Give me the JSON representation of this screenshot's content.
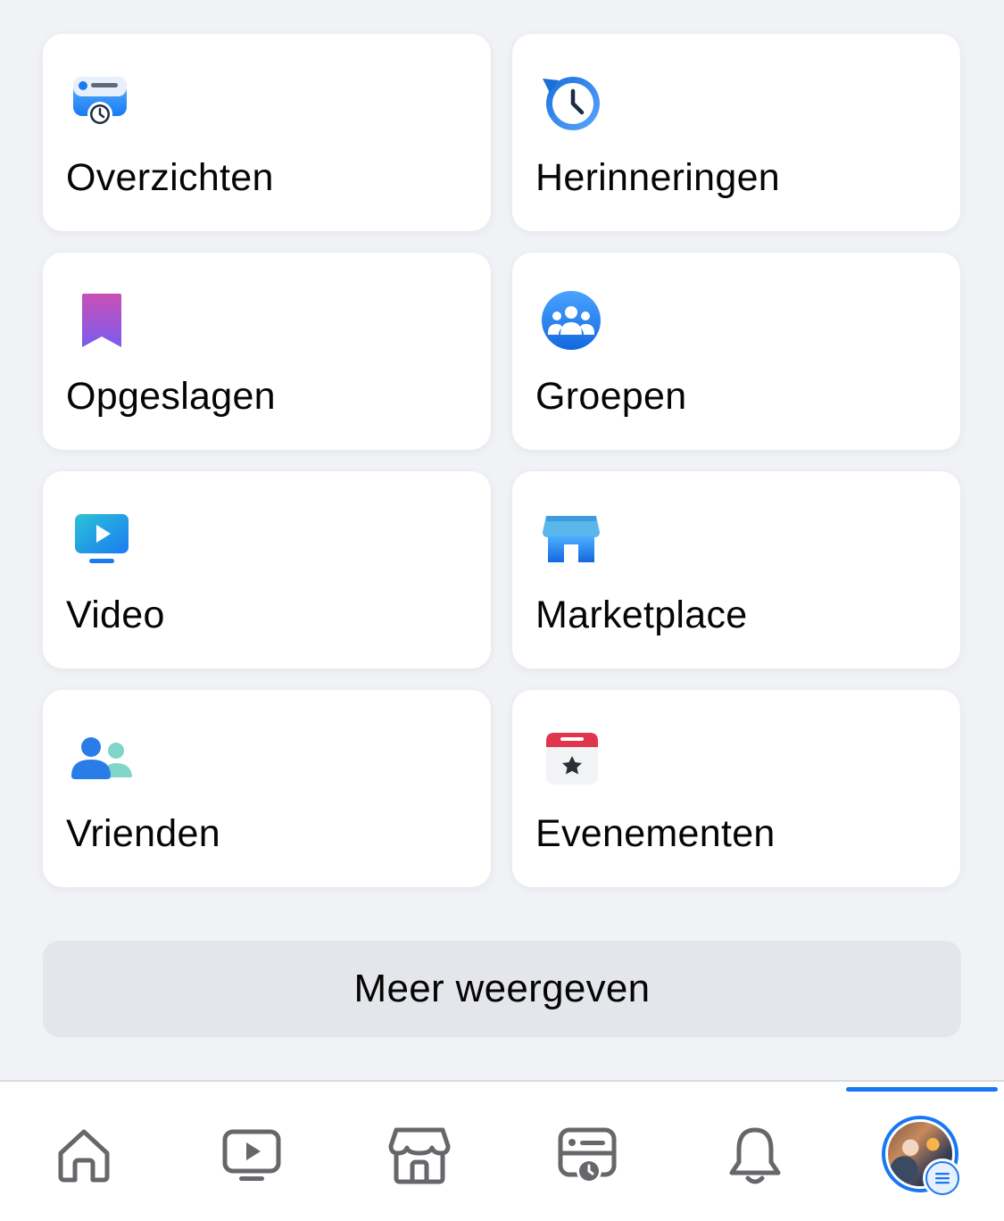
{
  "shortcuts": [
    {
      "label": "Overzichten",
      "icon": "feeds-icon"
    },
    {
      "label": "Herinneringen",
      "icon": "memories-clock-icon"
    },
    {
      "label": "Opgeslagen",
      "icon": "saved-bookmark-icon"
    },
    {
      "label": "Groepen",
      "icon": "groups-icon"
    },
    {
      "label": "Video",
      "icon": "video-monitor-icon"
    },
    {
      "label": "Marketplace",
      "icon": "marketplace-shop-icon"
    },
    {
      "label": "Vrienden",
      "icon": "friends-icon"
    },
    {
      "label": "Evenementen",
      "icon": "events-calendar-icon"
    }
  ],
  "more_button": {
    "label": "Meer weergeven"
  },
  "tabbar": {
    "tabs": [
      {
        "icon": "home-icon"
      },
      {
        "icon": "video-icon"
      },
      {
        "icon": "marketplace-icon"
      },
      {
        "icon": "feeds-icon"
      },
      {
        "icon": "notifications-bell-icon"
      },
      {
        "icon": "profile-menu-icon",
        "active": true
      }
    ]
  },
  "colors": {
    "background": "#f0f2f5",
    "card": "#ffffff",
    "accent": "#1877f2",
    "button": "#e4e6eb"
  }
}
